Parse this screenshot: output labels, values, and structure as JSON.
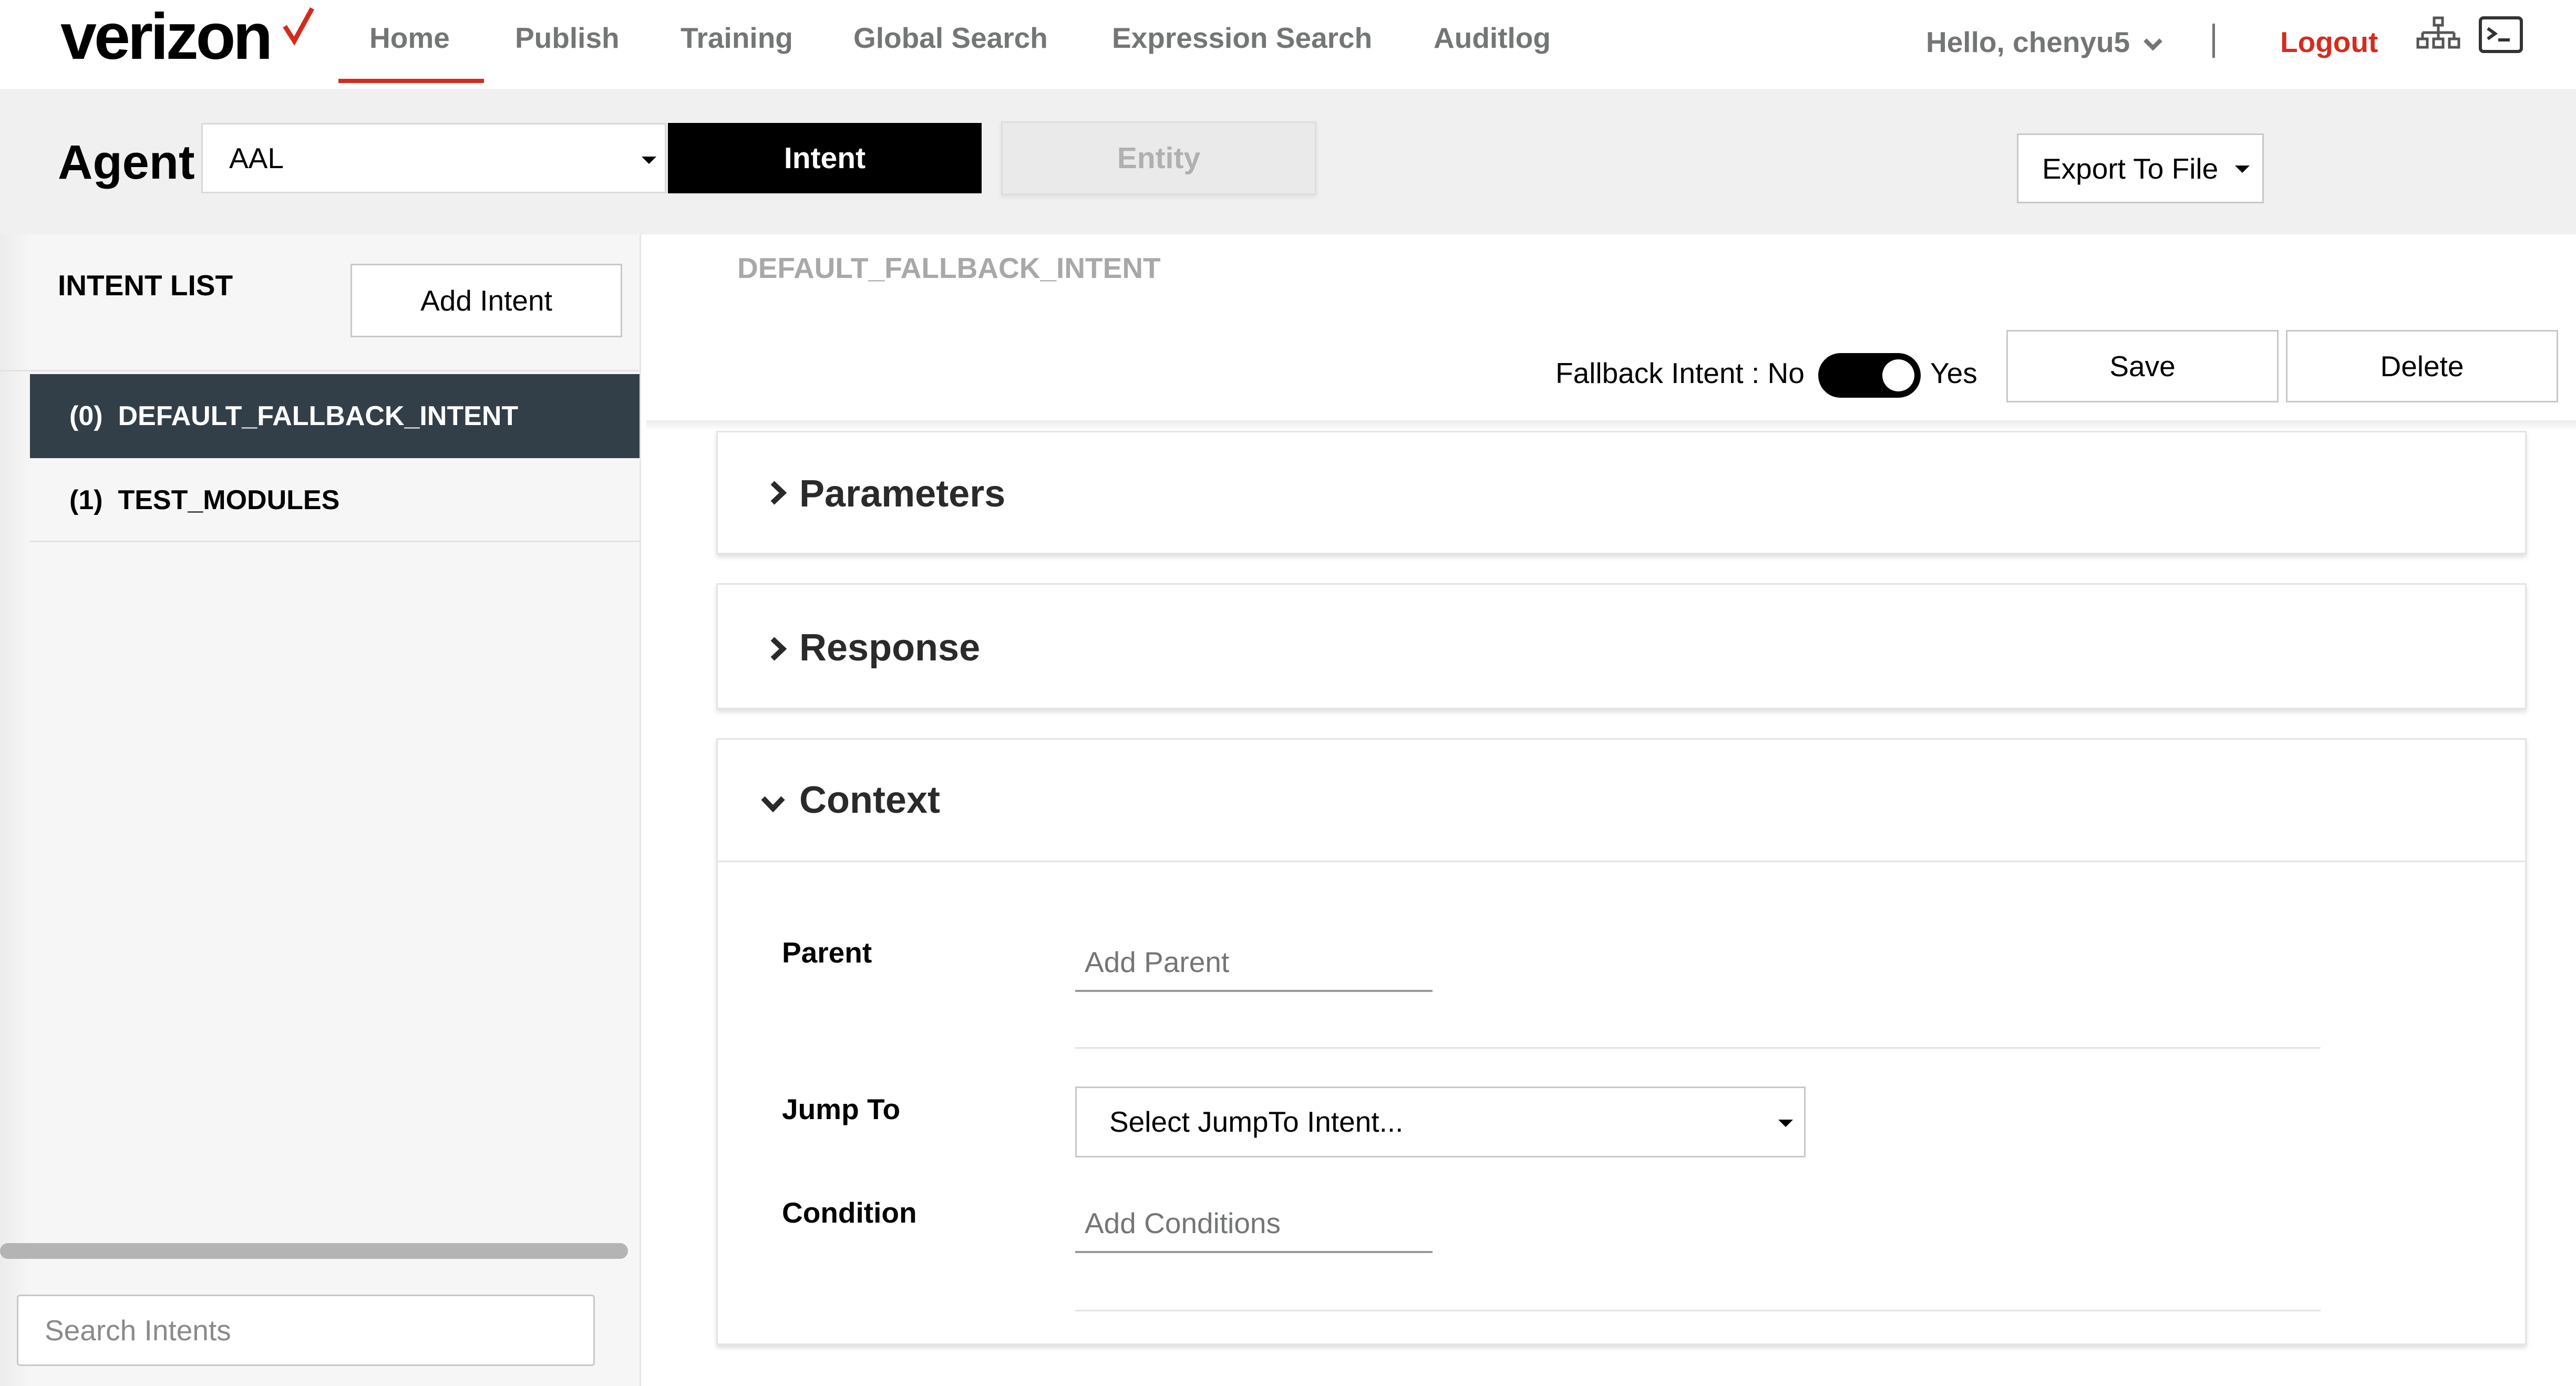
{
  "brand": {
    "name": "verizon",
    "accent": "#d52b1e",
    "dark": "#333f48"
  },
  "nav": {
    "items": [
      {
        "label": "Home"
      },
      {
        "label": "Publish"
      },
      {
        "label": "Training"
      },
      {
        "label": "Global Search"
      },
      {
        "label": "Expression Search"
      },
      {
        "label": "Auditlog"
      }
    ],
    "active": "Home",
    "greeting": "Hello, chenyu5",
    "logout": "Logout",
    "icons": [
      "sitemap-icon",
      "terminal-icon"
    ]
  },
  "agent_bar": {
    "label": "Agent",
    "selected_agent": "AAL",
    "tabs": [
      {
        "label": "Intent"
      },
      {
        "label": "Entity"
      }
    ],
    "active_tab": "Intent",
    "export_label": "Export To File"
  },
  "sidebar": {
    "title": "INTENT LIST",
    "add_button": "Add Intent",
    "intents": [
      {
        "index": "(0)",
        "name": "DEFAULT_FALLBACK_INTENT",
        "selected": true
      },
      {
        "index": "(1)",
        "name": "TEST_MODULES",
        "selected": false
      }
    ],
    "search_placeholder": "Search Intents"
  },
  "main": {
    "intent_title": "DEFAULT_FALLBACK_INTENT",
    "fallback_label": "Fallback Intent : No",
    "fallback_yes": "Yes",
    "fallback_on": true,
    "save_label": "Save",
    "delete_label": "Delete",
    "panels": [
      {
        "title": "Parameters",
        "expanded": false
      },
      {
        "title": "Response",
        "expanded": false
      },
      {
        "title": "Context",
        "expanded": true
      }
    ],
    "context": {
      "parent_label": "Parent",
      "parent_placeholder": "Add Parent",
      "jump_label": "Jump To",
      "jump_placeholder": "Select JumpTo Intent...",
      "condition_label": "Condition",
      "condition_placeholder": "Add Conditions"
    }
  }
}
